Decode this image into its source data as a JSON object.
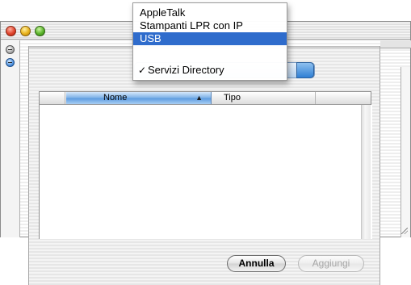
{
  "menu": {
    "items": [
      {
        "label": "AppleTalk",
        "selected": false,
        "checked": false
      },
      {
        "label": "Stampanti LPR con IP",
        "selected": false,
        "checked": false
      },
      {
        "label": "USB",
        "selected": true,
        "checked": false
      },
      {
        "label": "Servizi Directory",
        "selected": false,
        "checked": true
      }
    ],
    "checkmark_glyph": "✓"
  },
  "table": {
    "columns": [
      {
        "label": "Nome",
        "sorted": true,
        "sort_direction": "ascending"
      },
      {
        "label": "Tipo",
        "sorted": false
      }
    ],
    "sort_glyph": "▲",
    "rows": []
  },
  "buttons": {
    "cancel": "Annulla",
    "add": "Aggiungi"
  },
  "colors": {
    "selection": "#2f6ccc",
    "sorted_column": "#5b9ae0"
  },
  "icons": {
    "close": "close-traffic-light",
    "minimize": "minimize-traffic-light",
    "zoom": "zoom-traffic-light"
  }
}
